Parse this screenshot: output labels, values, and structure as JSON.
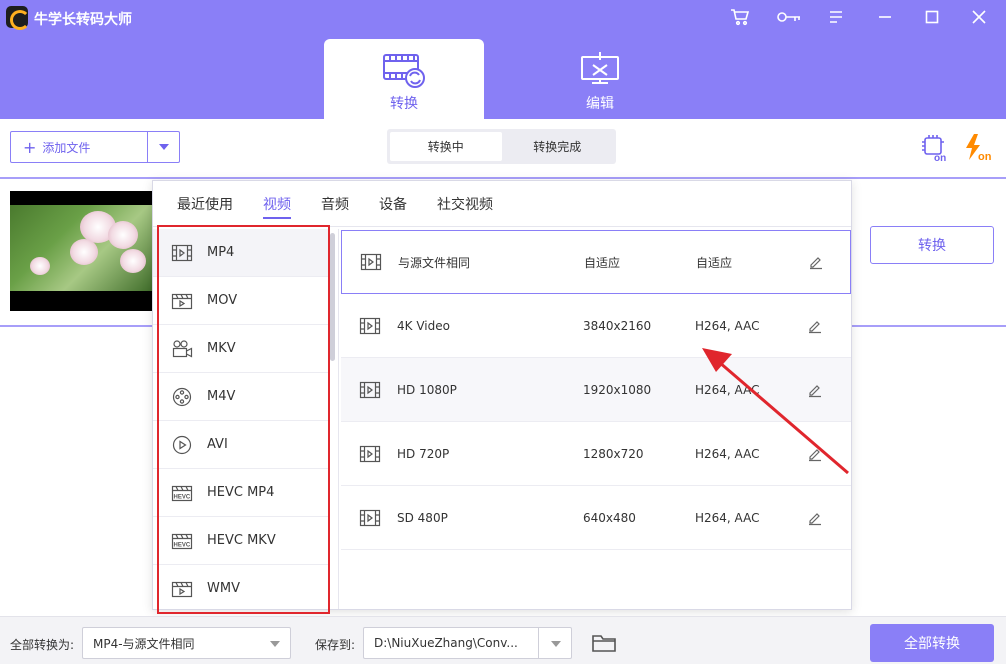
{
  "app": {
    "title": "牛学长转码大师"
  },
  "main_tabs": [
    {
      "label": "转换",
      "icon": "film-convert-icon",
      "active": true
    },
    {
      "label": "编辑",
      "icon": "edit-screen-icon",
      "active": false
    }
  ],
  "toolbar": {
    "add_file": "添加文件",
    "status_tabs": [
      {
        "label": "转换中",
        "active": true
      },
      {
        "label": "转换完成",
        "active": false
      }
    ]
  },
  "video_item": {
    "convert_button": "转换"
  },
  "format_panel": {
    "tabs": [
      {
        "label": "最近使用",
        "active": false
      },
      {
        "label": "视频",
        "active": true
      },
      {
        "label": "音频",
        "active": false
      },
      {
        "label": "设备",
        "active": false
      },
      {
        "label": "社交视频",
        "active": false
      }
    ],
    "formats": [
      {
        "label": "MP4",
        "icon": "film-strip-icon"
      },
      {
        "label": "MOV",
        "icon": "clapper-play-icon"
      },
      {
        "label": "MKV",
        "icon": "video-camera-icon"
      },
      {
        "label": "M4V",
        "icon": "film-reel-icon"
      },
      {
        "label": "AVI",
        "icon": "play-circle-icon"
      },
      {
        "label": "HEVC MP4",
        "icon": "hevc-icon"
      },
      {
        "label": "HEVC MKV",
        "icon": "hevc-icon"
      },
      {
        "label": "WMV",
        "icon": "clapper-play-icon"
      }
    ],
    "presets": [
      {
        "name": "与源文件相同",
        "resolution": "自适应",
        "codec": "自适应",
        "selected": true
      },
      {
        "name": "4K Video",
        "resolution": "3840x2160",
        "codec": "H264, AAC",
        "selected": false
      },
      {
        "name": "HD 1080P",
        "resolution": "1920x1080",
        "codec": "H264, AAC",
        "selected": false
      },
      {
        "name": "HD 720P",
        "resolution": "1280x720",
        "codec": "H264, AAC",
        "selected": false
      },
      {
        "name": "SD 480P",
        "resolution": "640x480",
        "codec": "H264, AAC",
        "selected": false
      }
    ]
  },
  "footer": {
    "convert_all_label": "全部转换为:",
    "convert_all_value": "MP4-与源文件相同",
    "save_to_label": "保存到:",
    "save_to_value": "D:\\NiuXueZhang\\Conv...",
    "convert_all_button": "全部转换"
  },
  "colors": {
    "accent": "#8a7ff7",
    "accent_text": "#6f62ee",
    "annotation_red": "#e0262d",
    "flash_orange": "#ff8a00"
  }
}
